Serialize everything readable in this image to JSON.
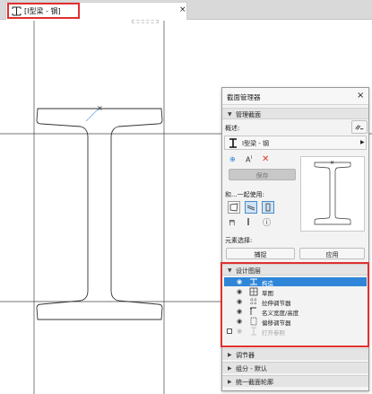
{
  "tab": {
    "title": "[I型梁 - 钢]",
    "close_label": "×",
    "icon": "profile-window-icon"
  },
  "panel": {
    "title": "截面管理器",
    "close_label": "×",
    "manage_section": "管理截面",
    "describe_label": "概述:",
    "profile_name": "I型梁 - 钢",
    "save_label": "保存",
    "use_with_label": "和...一起使用:",
    "element_select_label": "元素选择:",
    "capture_label": "捕捉",
    "apply_label": "应用",
    "design_layers": "设计图层",
    "layers": [
      {
        "label": "构造",
        "selected": true,
        "disabled": false
      },
      {
        "label": "草图",
        "selected": false,
        "disabled": false
      },
      {
        "label": "拉伸调节器",
        "selected": false,
        "disabled": false
      },
      {
        "label": "名义宽度/高度",
        "selected": false,
        "disabled": false
      },
      {
        "label": "偏移调节器",
        "selected": false,
        "disabled": false
      },
      {
        "label": "打开参照",
        "selected": false,
        "disabled": true
      }
    ],
    "bottom_sections": [
      "调节器",
      "组分 - 默认",
      "统一截面轮廓"
    ]
  },
  "colors": {
    "highlight": "#e0302e",
    "selection": "#2f86d9"
  }
}
